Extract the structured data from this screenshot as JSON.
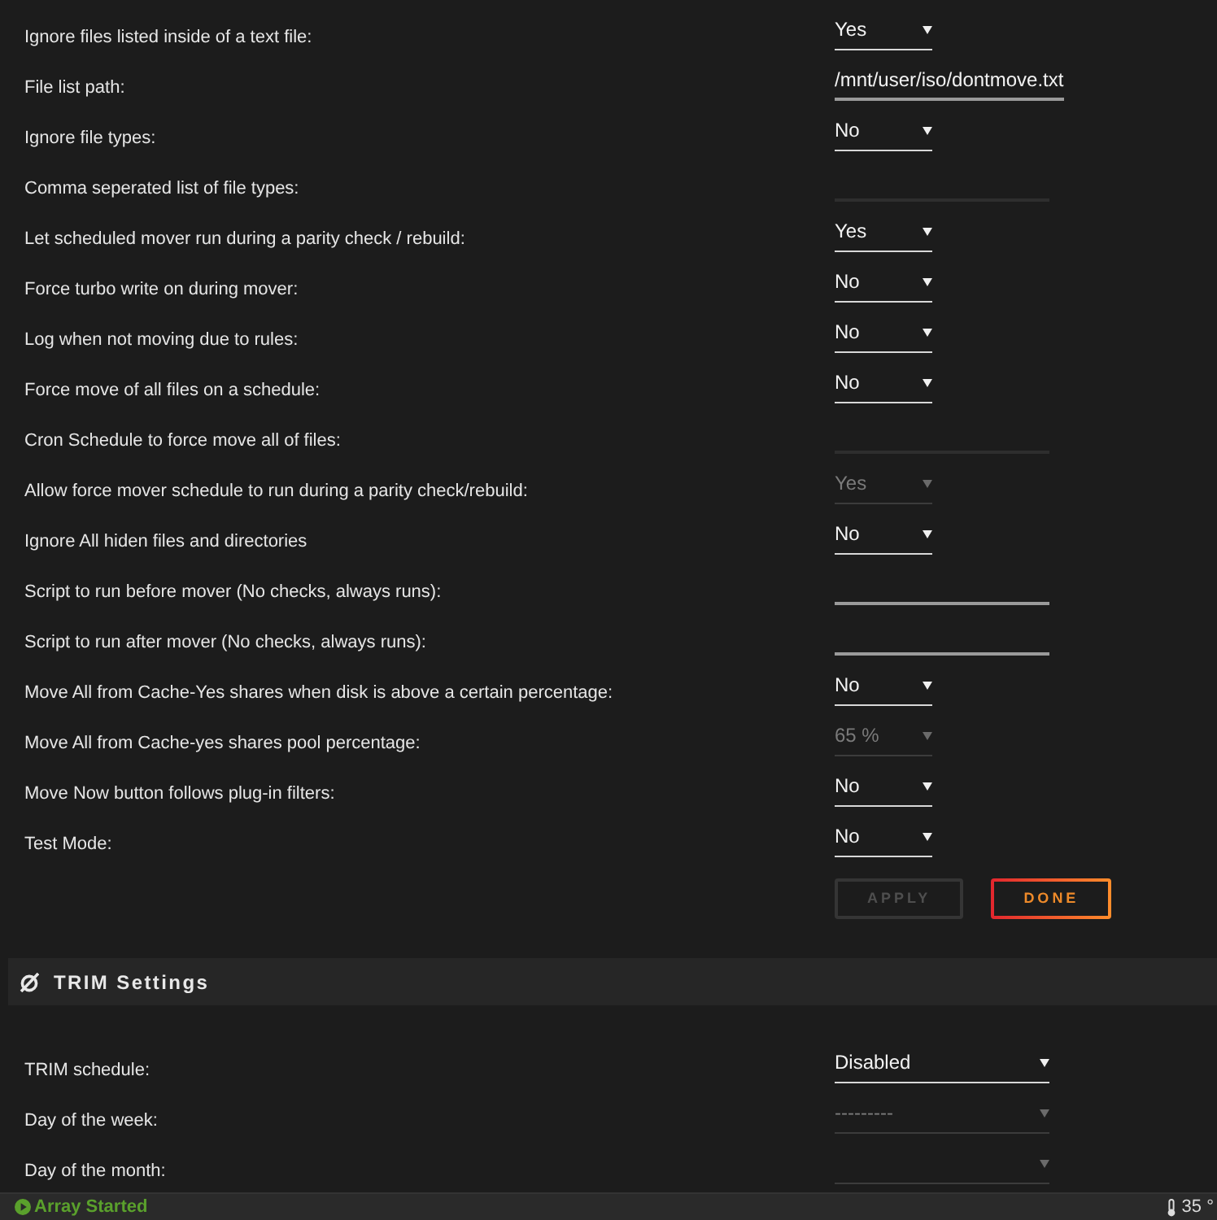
{
  "settings": [
    {
      "label": "Ignore files listed inside of a text file:",
      "control": {
        "kind": "select",
        "value": "Yes",
        "disabled": false
      }
    },
    {
      "label": "File list path:",
      "control": {
        "kind": "text",
        "value": "/mnt/user/iso/dontmove.txt",
        "disabled": false
      }
    },
    {
      "label": "Ignore file types:",
      "control": {
        "kind": "select",
        "value": "No",
        "disabled": false
      }
    },
    {
      "label": "Comma seperated list of file types:",
      "control": {
        "kind": "text",
        "disabled": true
      }
    },
    {
      "label": "Let scheduled mover run during a parity check / rebuild:",
      "control": {
        "kind": "select",
        "value": "Yes",
        "disabled": false
      }
    },
    {
      "label": "Force turbo write on during mover:",
      "control": {
        "kind": "select",
        "value": "No",
        "disabled": false
      }
    },
    {
      "label": "Log when not moving due to rules:",
      "control": {
        "kind": "select",
        "value": "No",
        "disabled": false
      }
    },
    {
      "label": "Force move of all files on a schedule:",
      "control": {
        "kind": "select",
        "value": "No",
        "disabled": false
      }
    },
    {
      "label": "Cron Schedule to force move all of files:",
      "control": {
        "kind": "text",
        "disabled": true
      }
    },
    {
      "label": "Allow force mover schedule to run during a parity check/rebuild:",
      "control": {
        "kind": "select",
        "value": "Yes",
        "disabled": true
      }
    },
    {
      "label": "Ignore All hiden files and directories",
      "control": {
        "kind": "select",
        "value": "No",
        "disabled": false
      }
    },
    {
      "label": "Script to run before mover (No checks, always runs):",
      "control": {
        "kind": "text",
        "disabled": false
      }
    },
    {
      "label": "Script to run after mover (No checks, always runs):",
      "control": {
        "kind": "text",
        "disabled": false
      }
    },
    {
      "label": "Move All from Cache-Yes shares when disk is above a certain percentage:",
      "control": {
        "kind": "select",
        "value": "No",
        "disabled": false
      }
    },
    {
      "label": "Move All from Cache-yes shares pool percentage:",
      "control": {
        "kind": "select",
        "value": "65 %",
        "disabled": true
      }
    },
    {
      "label": "Move Now button follows plug-in filters:",
      "control": {
        "kind": "select",
        "value": "No",
        "disabled": false
      }
    },
    {
      "label": "Test Mode:",
      "control": {
        "kind": "select",
        "value": "No",
        "disabled": false
      }
    }
  ],
  "buttons": [
    {
      "label": "APPLY",
      "disabled": true
    },
    {
      "label": "DONE",
      "disabled": false
    }
  ],
  "trim": {
    "title": "TRIM Settings",
    "settings": [
      {
        "label": "TRIM schedule:",
        "control": {
          "kind": "select",
          "value": "Disabled",
          "disabled": false
        }
      },
      {
        "label": "Day of the week:",
        "control": {
          "kind": "select",
          "value": "---------",
          "disabled": true
        }
      },
      {
        "label": "Day of the month:",
        "control": {
          "kind": "select",
          "disabled": true
        }
      }
    ]
  },
  "status_bar": {
    "array_status": "Array Started",
    "temperature": "35 °"
  }
}
